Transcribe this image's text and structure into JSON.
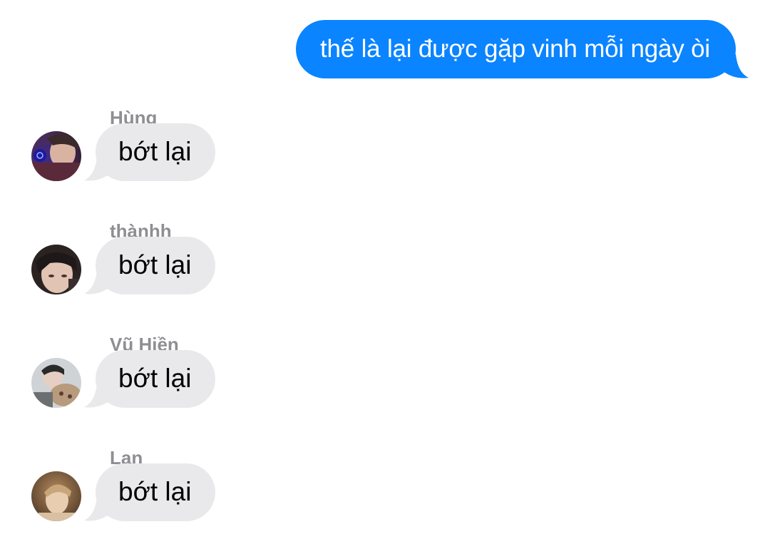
{
  "outgoing": {
    "text": "thế là lại được gặp vinh mỗi ngày òi",
    "bubble_color": "#0a84ff"
  },
  "messages": [
    {
      "sender": "Hùng",
      "text": "bớt lại",
      "avatar": "avatar-photo"
    },
    {
      "sender": "thànhh",
      "text": "bớt lại",
      "avatar": "avatar-photo"
    },
    {
      "sender": "Vũ Hiền",
      "text": "bớt lại",
      "avatar": "avatar-photo"
    },
    {
      "sender": "Lan",
      "text": "bớt lại",
      "avatar": "avatar-photo"
    }
  ],
  "colors": {
    "incoming_bubble": "#e9e9eb",
    "sender_name": "#8e8e93",
    "background": "#ffffff"
  }
}
